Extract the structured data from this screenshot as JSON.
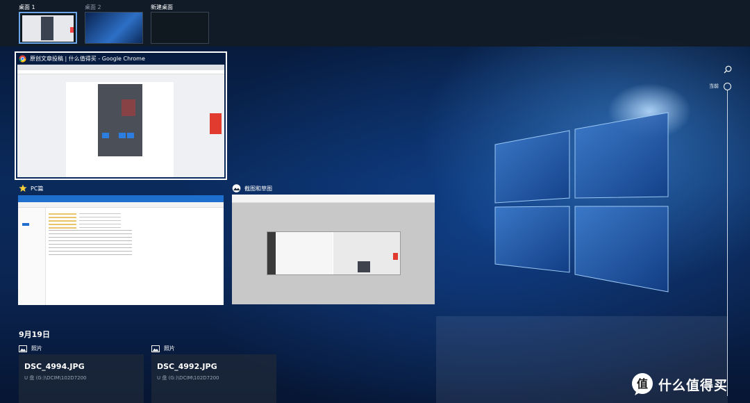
{
  "desktops": [
    {
      "label": "桌面 1",
      "active": true
    },
    {
      "label": "桌面 2",
      "active": false
    },
    {
      "label": "新建桌面",
      "active": false
    }
  ],
  "windows": {
    "chrome": {
      "title": "原创文章投稿 | 什么值得买 - Google Chrome",
      "icon": "chrome-icon"
    },
    "explorer": {
      "title": "PC篇",
      "icon": "star-icon"
    },
    "snip": {
      "title": "截图和草图",
      "icon": "snip-sketch-icon"
    }
  },
  "timeline": {
    "date": "9月19日",
    "app": "照片",
    "cards": [
      {
        "app": "照片",
        "title": "DSC_4994.JPG",
        "path": "U 盘 (G:)\\DCIM\\102D7200"
      },
      {
        "app": "照片",
        "title": "DSC_4992.JPG",
        "path": "U 盘 (G:)\\DCIM\\102D7200"
      }
    ]
  },
  "scrubber": {
    "current_label": "当前"
  },
  "watermark": {
    "text": "什么值得买",
    "glyph": "值"
  },
  "colors": {
    "accent": "#6aa6e8",
    "taskbar": "#121b26"
  }
}
